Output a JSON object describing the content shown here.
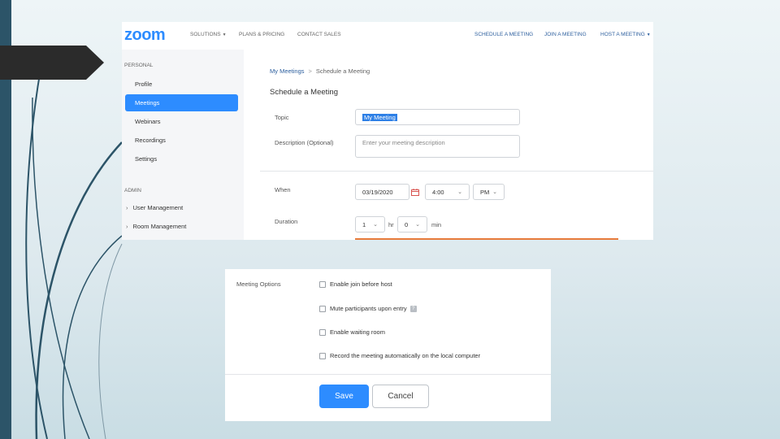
{
  "header": {
    "logo": "zoom",
    "nav_left": [
      "SOLUTIONS",
      "PLANS & PRICING",
      "CONTACT SALES"
    ],
    "nav_right": [
      "SCHEDULE A MEETING",
      "JOIN A MEETING",
      "HOST A MEETING"
    ]
  },
  "sidebar": {
    "personal_heading": "PERSONAL",
    "items": [
      "Profile",
      "Meetings",
      "Webinars",
      "Recordings",
      "Settings"
    ],
    "active_item": "Meetings",
    "admin_heading": "ADMIN",
    "admin_items": [
      "User Management",
      "Room Management"
    ]
  },
  "breadcrumb": {
    "parent": "My Meetings",
    "separator": ">",
    "current": "Schedule a Meeting"
  },
  "form": {
    "title": "Schedule a Meeting",
    "topic_label": "Topic",
    "topic_value": "My Meeting",
    "description_label": "Description (Optional)",
    "description_placeholder": "Enter your meeting description",
    "when_label": "When",
    "date_value": "03/19/2020",
    "time_value": "4:00",
    "ampm_value": "PM",
    "duration_label": "Duration",
    "duration_hours": "1",
    "hours_unit": "hr",
    "duration_minutes": "0",
    "minutes_unit": "min"
  },
  "options": {
    "heading": "Meeting Options",
    "items": [
      "Enable join before host",
      "Mute participants upon entry",
      "Enable waiting room",
      "Record the meeting automatically on the local computer"
    ],
    "info_icon": "?"
  },
  "buttons": {
    "save": "Save",
    "cancel": "Cancel"
  },
  "colors": {
    "accent": "#2d8cff",
    "slide_bar": "#2c5468",
    "divider_orange": "#e77b3b"
  }
}
